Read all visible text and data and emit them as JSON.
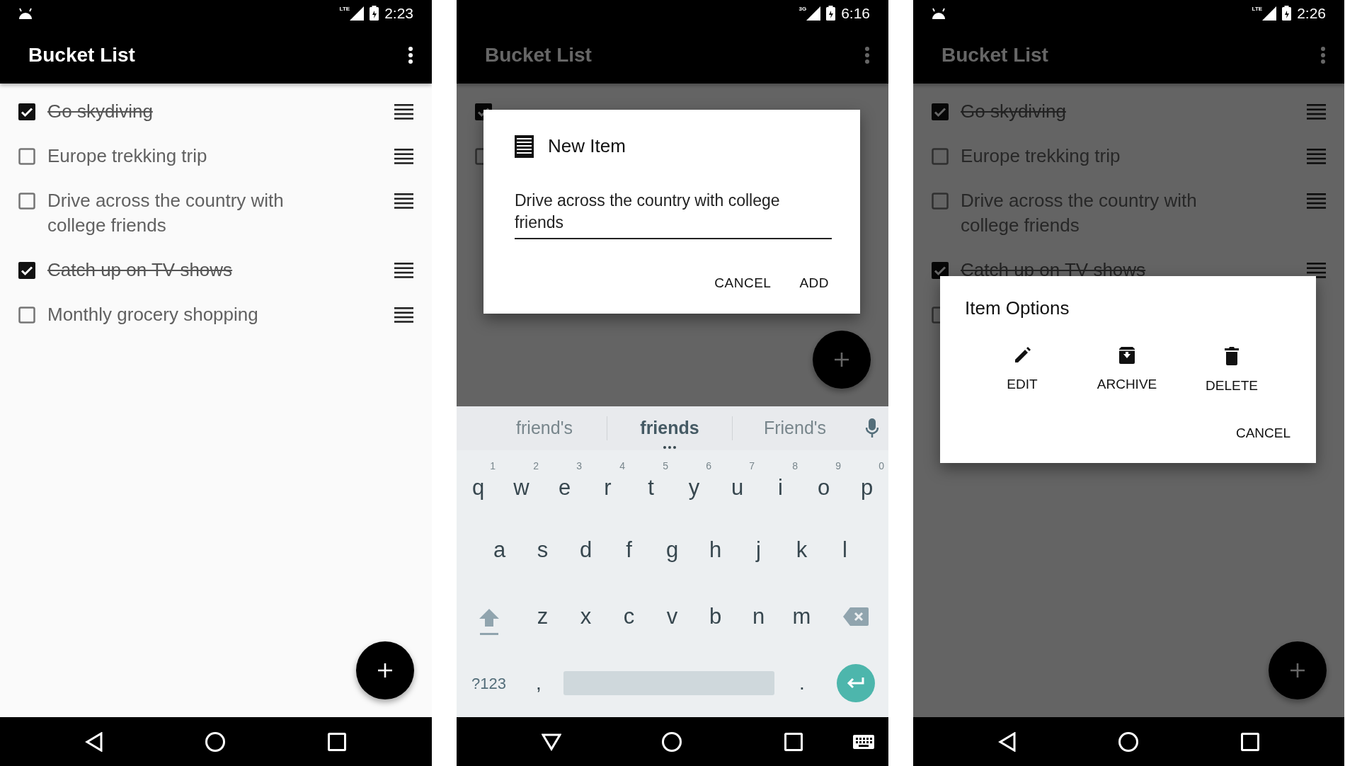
{
  "screens": [
    {
      "kind": "list",
      "status_bar": {
        "notification_icon": true,
        "network": "LTE",
        "time": "2:23"
      },
      "app_bar": {
        "title": "Bucket List"
      },
      "items": [
        {
          "text": "Go skydiving",
          "checked": true
        },
        {
          "text": "Europe trekking trip",
          "checked": false
        },
        {
          "text": "Drive across the country with college friends",
          "checked": false
        },
        {
          "text": "Catch up on TV shows",
          "checked": true
        },
        {
          "text": "Monthly grocery shopping",
          "checked": false
        }
      ],
      "nav_bar": {
        "kind": "standard"
      }
    },
    {
      "kind": "new_item",
      "status_bar": {
        "notification_icon": false,
        "network": "3G",
        "time": "6:16"
      },
      "app_bar": {
        "title": "Bucket List"
      },
      "items": [
        {
          "checked": true
        },
        {
          "checked": false
        }
      ],
      "dialog": {
        "title": "New Item",
        "value": "Drive across the country with college friends",
        "buttons": [
          "CANCEL",
          "ADD"
        ]
      },
      "keyboard": {
        "suggestions": [
          {
            "text": "friend's",
            "selected": false
          },
          {
            "text": "friends",
            "selected": true
          },
          {
            "text": "Friend's",
            "selected": false
          }
        ],
        "rows": [
          [
            {
              "label": "q",
              "hint": "1"
            },
            {
              "label": "w",
              "hint": "2"
            },
            {
              "label": "e",
              "hint": "3"
            },
            {
              "label": "r",
              "hint": "4"
            },
            {
              "label": "t",
              "hint": "5"
            },
            {
              "label": "y",
              "hint": "6"
            },
            {
              "label": "u",
              "hint": "7"
            },
            {
              "label": "i",
              "hint": "8"
            },
            {
              "label": "o",
              "hint": "9"
            },
            {
              "label": "p",
              "hint": "0"
            }
          ],
          [
            {
              "label": "a"
            },
            {
              "label": "s"
            },
            {
              "label": "d"
            },
            {
              "label": "f"
            },
            {
              "label": "g"
            },
            {
              "label": "h"
            },
            {
              "label": "j"
            },
            {
              "label": "k"
            },
            {
              "label": "l"
            }
          ],
          [
            {
              "label": "z"
            },
            {
              "label": "x"
            },
            {
              "label": "c"
            },
            {
              "label": "v"
            },
            {
              "label": "b"
            },
            {
              "label": "n"
            },
            {
              "label": "m"
            }
          ]
        ],
        "symbols_key": "?123",
        "comma_key": ",",
        "period_key": "."
      },
      "nav_bar": {
        "kind": "keyboard_open"
      }
    },
    {
      "kind": "options",
      "status_bar": {
        "notification_icon": true,
        "network": "LTE",
        "time": "2:26"
      },
      "app_bar": {
        "title": "Bucket List"
      },
      "items": [
        {
          "text": "Go skydiving",
          "checked": true
        },
        {
          "text": "Europe trekking trip",
          "checked": false
        },
        {
          "text": "Drive across the country with college friends",
          "checked": false
        },
        {
          "text": "Catch up on TV shows",
          "checked": true
        },
        {
          "checked": false
        }
      ],
      "dialog": {
        "title": "Item Options",
        "options": [
          {
            "kind": "edit",
            "label": "EDIT"
          },
          {
            "kind": "archive",
            "label": "ARCHIVE"
          },
          {
            "kind": "delete",
            "label": "DELETE"
          }
        ],
        "buttons": [
          "CANCEL"
        ]
      },
      "nav_bar": {
        "kind": "standard"
      }
    }
  ]
}
